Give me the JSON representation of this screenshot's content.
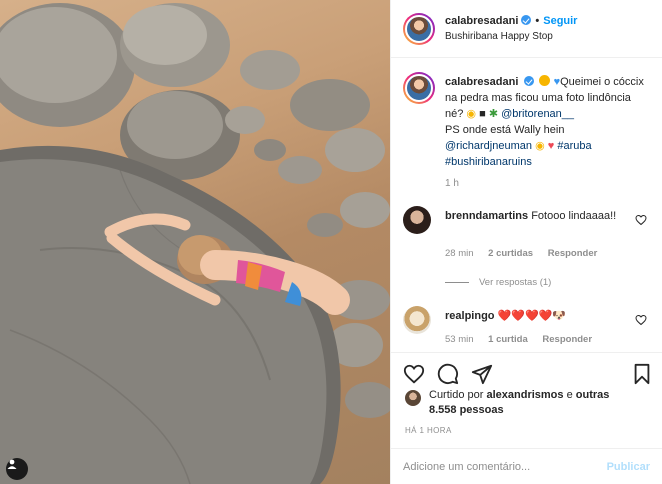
{
  "post": {
    "author": "calabresadani",
    "follow_label": "Seguir",
    "location": "Bushiribana Happy Stop"
  },
  "caption": {
    "username": "calabresadani",
    "text_1": "Queimei o cóccix na pedra mas ficou uma foto lindôncia né?",
    "mention_1": "@britorenan__",
    "text_2": "PS onde está Wally hein",
    "mention_2": "@richardjneuman",
    "hashtag_1": "#aruba",
    "hashtag_2": "#bushiribanaruins",
    "time": "1 h"
  },
  "comments": [
    {
      "username": "brenndamartins",
      "text": "Fotooo lindaaaa!!",
      "time": "28 min",
      "likes": "2 curtidas",
      "reply": "Responder",
      "view_replies": "Ver respostas (1)"
    },
    {
      "username": "realpingo",
      "text": "❤️❤️❤️❤️🐶",
      "time": "53 min",
      "likes": "1 curtida",
      "reply": "Responder"
    }
  ],
  "liked_by": {
    "prefix": "Curtido por",
    "user": "alexandrismos",
    "joiner": "e",
    "others": "outras 8.558 pessoas"
  },
  "posted_ago": "HÁ 1 HORA",
  "add_comment": {
    "placeholder": "Adicione um comentário...",
    "publish": "Publicar"
  },
  "colors": {
    "accent": "#0095f6",
    "heart": "#ed4956",
    "muted": "#8e8e8e"
  }
}
